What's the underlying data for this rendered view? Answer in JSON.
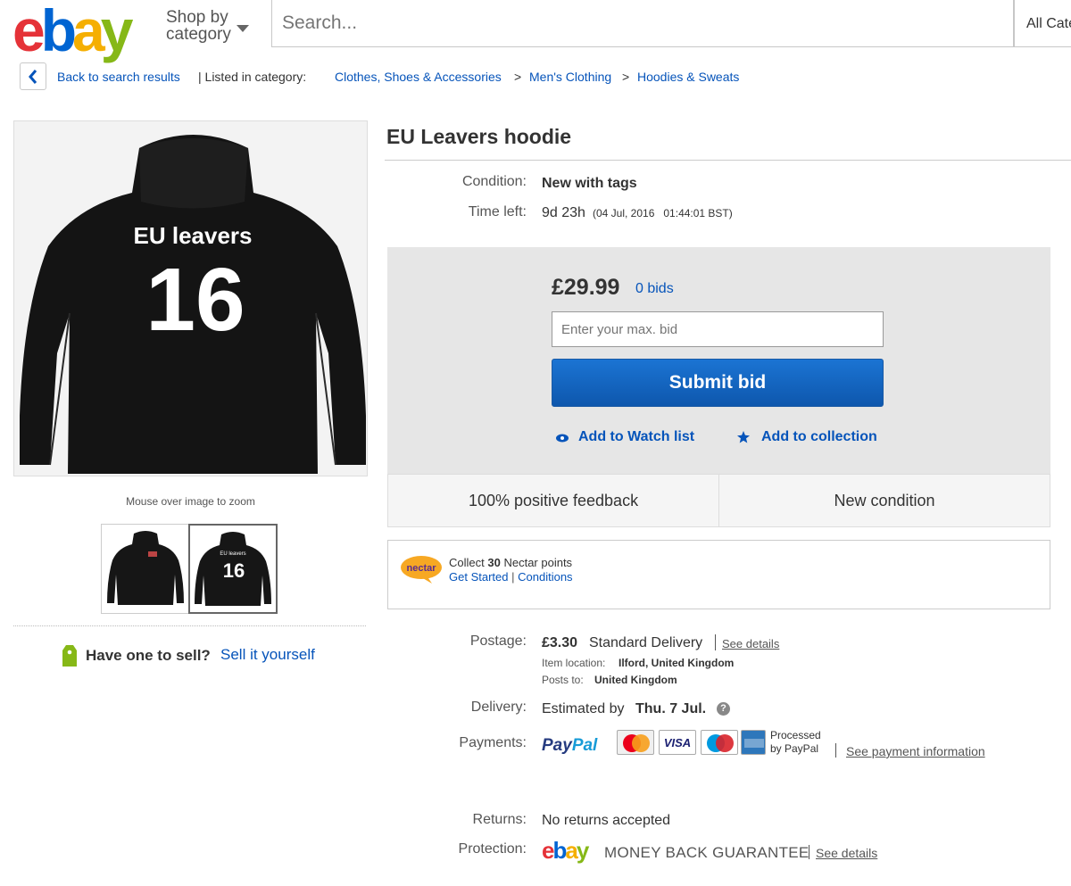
{
  "header": {
    "logo": [
      "e",
      "b",
      "a",
      "y"
    ],
    "shop_by": "Shop by",
    "category": "category",
    "search_placeholder": "Search...",
    "all_categories": "All Categories"
  },
  "breadcrumb": {
    "back": "Back to search results",
    "listed_in": "| Listed in category:",
    "items": [
      "Clothes, Shoes & Accessories",
      "Men's Clothing",
      "Hoodies & Sweats"
    ],
    "separator": ">"
  },
  "gallery": {
    "main_text_line1": "EU leavers",
    "main_text_line2": "16",
    "zoom_hint": "Mouse over image to zoom",
    "thumb2_line1": "EU leavers",
    "thumb2_line2": "16"
  },
  "sell": {
    "prompt": "Have one to sell?",
    "link": "Sell it yourself"
  },
  "item": {
    "title": "EU Leavers hoodie",
    "condition_label": "Condition:",
    "condition_value": "New with tags",
    "time_left_label": "Time left:",
    "time_left_value": "9d 23h",
    "time_left_detail": "(04 Jul, 2016   01:44:01 BST)"
  },
  "bidding": {
    "price": "£29.99",
    "bids": "0 bids",
    "max_bid_placeholder": "Enter your max. bid",
    "submit": "Submit bid",
    "watch": "Add to Watch list",
    "collection": "Add to collection"
  },
  "badges": {
    "feedback": "100% positive feedback",
    "condition": "New condition"
  },
  "nectar": {
    "logo_text": "nectar",
    "collect_prefix": "Collect",
    "points": "30",
    "collect_suffix": "Nectar points",
    "get_started": "Get Started",
    "conditions": "Conditions"
  },
  "postage": {
    "label": "Postage:",
    "price": "£3.30",
    "service": "Standard Delivery",
    "see_details": "See details",
    "location_label": "Item location:",
    "location": "Ilford, United Kingdom",
    "posts_to_label": "Posts to:",
    "posts_to": "United Kingdom"
  },
  "delivery": {
    "label": "Delivery:",
    "prefix": "Estimated by",
    "date": "Thu. 7 Jul.",
    "help": "?"
  },
  "payments": {
    "label": "Payments:",
    "paypal_1": "Pay",
    "paypal_2": "Pal",
    "cards": [
      "MasterCard",
      "VISA",
      "Maestro",
      "American Express"
    ],
    "processed_1": "Processed",
    "processed_2": "by PayPal",
    "see_info": "See payment information"
  },
  "returns": {
    "label": "Returns:",
    "value": "No returns accepted"
  },
  "protection": {
    "label": "Protection:",
    "guarantee": "MONEY BACK GUARANTEE",
    "see_details": "See details"
  },
  "colors": {
    "accent": "#0654ba",
    "submit": "#0e57ad",
    "ebay_red": "#e53238",
    "ebay_blue": "#0064d2",
    "ebay_yellow": "#f5af02",
    "ebay_green": "#86b817"
  }
}
